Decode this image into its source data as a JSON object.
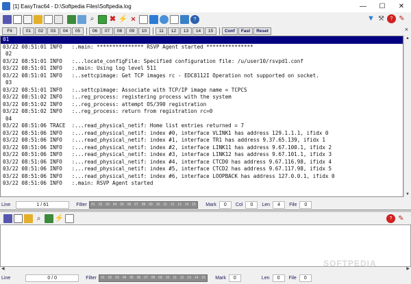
{
  "window": {
    "title": "[1] EasyTrac64 - D:\\Softpedia Files\\Softpedia.log",
    "min_glyph": "—",
    "max_glyph": "☐",
    "close_glyph": "✕"
  },
  "toolbar1": {
    "icons": [
      "save-icon",
      "copy-icon",
      "paste-icon",
      "open-icon",
      "document-icon",
      "print-icon",
      "table-icon",
      "image-icon",
      "search-icon",
      "monitor-icon",
      "close-red-icon",
      "lightning-icon",
      "delete-icon",
      "page-icon",
      "export-icon",
      "timer-icon",
      "font-icon",
      "calendar-icon",
      "help-icon"
    ],
    "right_icons": [
      "filter-icon",
      "tools-icon",
      "question-icon",
      "pen-icon"
    ]
  },
  "toolbar2": {
    "fit": "Fit",
    "group1": [
      "01",
      "02",
      "03",
      "04",
      "05"
    ],
    "group2": [
      "06",
      "07",
      "08",
      "09",
      "10"
    ],
    "group3": [
      "11",
      "12",
      "13",
      "14",
      "15"
    ],
    "conf": "Conf",
    "fast": "Fast",
    "reset": "Reset",
    "close_glyph": "×"
  },
  "log": {
    "lines": [
      {
        "text": "01",
        "type": "sel"
      },
      {
        "text": "03/22 08:51:01 INFO   :.main: *************** RSVP Agent started ***************",
        "type": "normal"
      },
      {
        "text": "02",
        "type": "sep"
      },
      {
        "text": "03/22 08:51:01 INFO   :...locate_configFile: Specified configuration file: /u/user10/rsvpd1.conf",
        "type": "normal"
      },
      {
        "text": "03/22 08:51:01 INFO   :.main: Using log level 511",
        "type": "normal"
      },
      {
        "text": "03/22 08:51:01 INFO   :..settcpimage: Get TCP images rc - EDC8112I Operation not supported on socket.",
        "type": "normal"
      },
      {
        "text": "03",
        "type": "sep"
      },
      {
        "text": "03/22 08:51:01 INFO   :..settcpimage: Associate with TCP/IP image name = TCPCS",
        "type": "normal"
      },
      {
        "text": "03/22 08:51:02 INFO   :..reg_process: registering process with the system",
        "type": "normal"
      },
      {
        "text": "03/22 08:51:02 INFO   :..reg_process: attempt OS/390 registration",
        "type": "normal"
      },
      {
        "text": "03/22 08:51:02 INFO   :..reg_process: return from registration rc=0",
        "type": "normal"
      },
      {
        "text": "04",
        "type": "sep"
      },
      {
        "text": "03/22 08:51:06 TRACE  :...read_physical_netif: Home list entries returned = 7",
        "type": "normal"
      },
      {
        "text": "03/22 08:51:06 INFO   :...read_physical_netif: index #0, interface VLINK1 has address 129.1.1.1, ifidx 0",
        "type": "normal"
      },
      {
        "text": "03/22 08:51:06 INFO   :...read_physical_netif: index #1, interface TR1 has address 9.37.65.139, ifidx 1",
        "type": "normal"
      },
      {
        "text": "03/22 08:51:06 INFO   :...read_physical_netif: index #2, interface LINK11 has address 9.67.100.1, ifidx 2",
        "type": "normal"
      },
      {
        "text": "03/22 08:51:06 INFO   :...read_physical_netif: index #3, interface LINK12 has address 9.67.101.1, ifidx 3",
        "type": "normal"
      },
      {
        "text": "03/22 08:51:06 INFO   :...read_physical_netif: index #4, interface CTCD0 has address 9.67.116.98, ifidx 4",
        "type": "normal"
      },
      {
        "text": "03/22 08:51:06 INFO   :...read_physical_netif: index #5, interface CTCD2 has address 9.67.117.98, ifidx 5",
        "type": "normal"
      },
      {
        "text": "03/22 08:51:06 INFO   :...read_physical_netif: index #6, interface LOOPBACK has address 127.0.0.1, ifidx 0",
        "type": "normal"
      },
      {
        "text": "03/22 08:51:06 INFO   :.main: RSVP Agent started",
        "type": "normal"
      }
    ]
  },
  "status_top": {
    "line_label": "Line",
    "line_value": "1 / 61",
    "filter_label": "Filter",
    "filter_cells": [
      "01",
      "02",
      "03",
      "04",
      "05",
      "06",
      "07",
      "08",
      "09",
      "10",
      "11",
      "12",
      "13",
      "14",
      "15"
    ],
    "mark_label": "Mark",
    "mark_value": "0",
    "col_label": "Col",
    "col_value": "0",
    "len_label": "Len",
    "len_value": "4",
    "file_label": "File",
    "file_value": "0"
  },
  "toolbar3": {
    "icons": [
      "save-icon",
      "copy-icon",
      "open-icon",
      "search-icon",
      "table-icon",
      "lightning-icon",
      "page-icon"
    ],
    "right_icons": [
      "question-icon",
      "pen-icon"
    ]
  },
  "status_bottom": {
    "line_label": "Line",
    "line_value": "0 / 0",
    "filter_label": "Filter",
    "filter_cells": [
      "01",
      "02",
      "03",
      "04",
      "05",
      "06",
      "07",
      "08",
      "09",
      "10",
      "11",
      "12",
      "13",
      "14",
      "15"
    ],
    "mark_label": "Mark",
    "mark_value": "0",
    "len_label": "Len",
    "len_value": "0",
    "file_label": "File",
    "file_value": "0"
  },
  "watermark": "SOFTPEDIA",
  "colors": {
    "selection": "#000080",
    "filter_cells": "#8c8c8c"
  }
}
